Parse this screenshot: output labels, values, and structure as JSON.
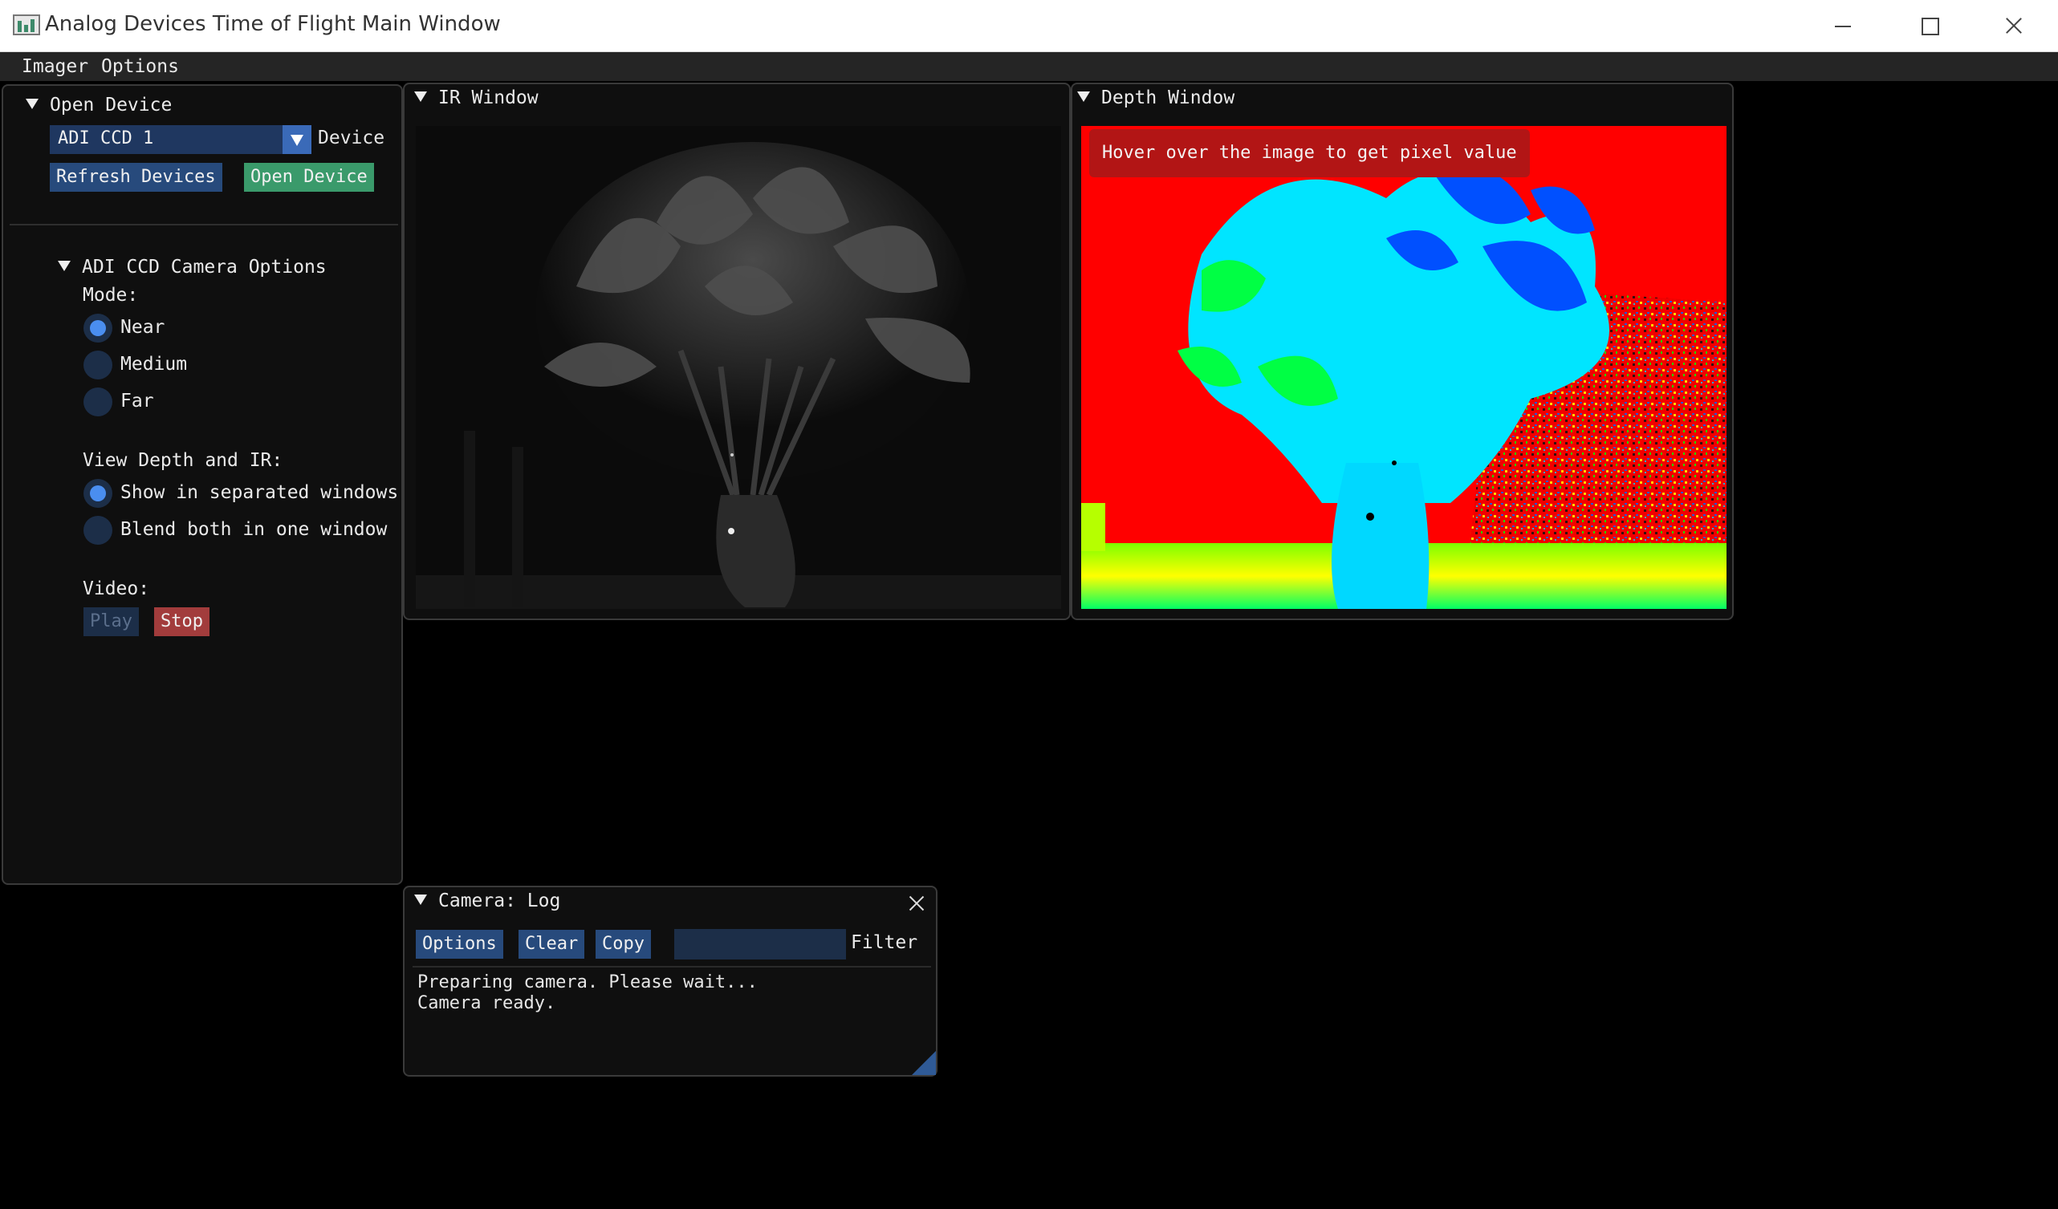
{
  "window": {
    "title": "Analog Devices Time of Flight Main Window"
  },
  "menu": {
    "items": [
      "Imager",
      "Options"
    ]
  },
  "control_panel": {
    "section_title": "Open Device",
    "device_combo_value": "ADI CCD 1",
    "device_label": "Device",
    "refresh_button": "Refresh Devices",
    "open_button": "Open Device",
    "camera_options_title": "ADI CCD Camera Options",
    "mode_label": "Mode:",
    "modes": [
      {
        "label": "Near",
        "selected": true
      },
      {
        "label": "Medium",
        "selected": false
      },
      {
        "label": "Far",
        "selected": false
      }
    ],
    "view_label": "View Depth and IR:",
    "view_options": [
      {
        "label": "Show in separated windows",
        "selected": true
      },
      {
        "label": "Blend both in one window",
        "selected": false
      }
    ],
    "video_label": "Video:",
    "play_button": "Play",
    "stop_button": "Stop"
  },
  "ir_window": {
    "title": "IR Window"
  },
  "depth_window": {
    "title": "Depth Window",
    "tooltip": "Hover over the image to get pixel value"
  },
  "log_window": {
    "title": "Camera: Log",
    "options_button": "Options",
    "clear_button": "Clear",
    "copy_button": "Copy",
    "filter_value": "",
    "filter_label": "Filter",
    "lines": [
      "Preparing camera. Please wait...",
      "Camera ready."
    ]
  },
  "colors": {
    "accent_blue": "#4a8ef0",
    "button_blue": "#274a7c",
    "open_green": "#3a9a6b",
    "stop_red": "#a23c3c",
    "depth_background": "#ff0000"
  },
  "icons": {
    "app": "tof-app-icon",
    "minimize": "minimize-icon",
    "maximize": "maximize-icon",
    "close": "close-icon"
  }
}
